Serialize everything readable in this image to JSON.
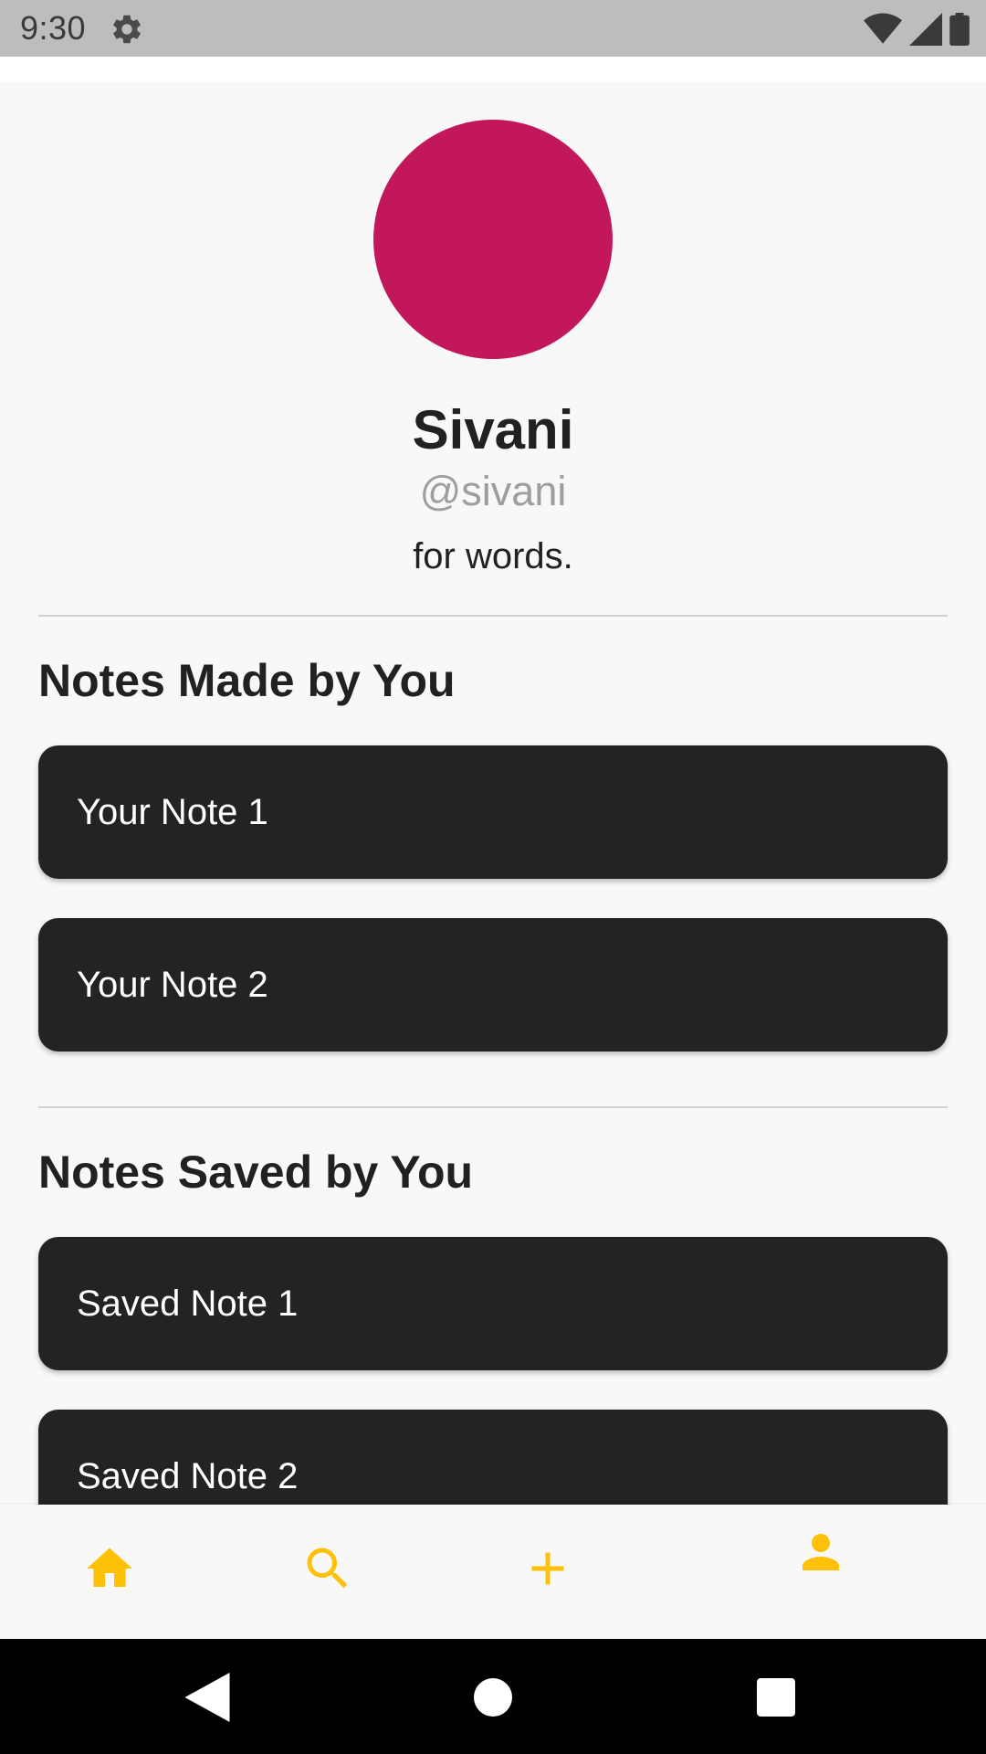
{
  "status_bar": {
    "time": "9:30",
    "icons": [
      "settings-icon",
      "wifi-icon",
      "cell-signal-icon",
      "battery-icon"
    ]
  },
  "profile": {
    "avatar_color": "#c2185b",
    "name": "Sivani",
    "handle": "@sivani",
    "bio": "for words."
  },
  "sections": {
    "made": {
      "title": "Notes Made by You",
      "notes": [
        "Your Note 1",
        "Your Note 2"
      ]
    },
    "saved": {
      "title": "Notes Saved by You",
      "notes": [
        "Saved Note 1",
        "Saved Note 2"
      ]
    }
  },
  "bottom_nav": {
    "accent_color": "#ffc107",
    "items": [
      "home-icon",
      "search-icon",
      "add-icon",
      "profile-icon"
    ]
  },
  "system_nav": {
    "items": [
      "back-icon",
      "home-circle-icon",
      "recents-icon"
    ]
  },
  "colors": {
    "card_bg": "#232323",
    "page_bg": "#f8f8f8",
    "status_bar_bg": "#bdbdbd"
  }
}
